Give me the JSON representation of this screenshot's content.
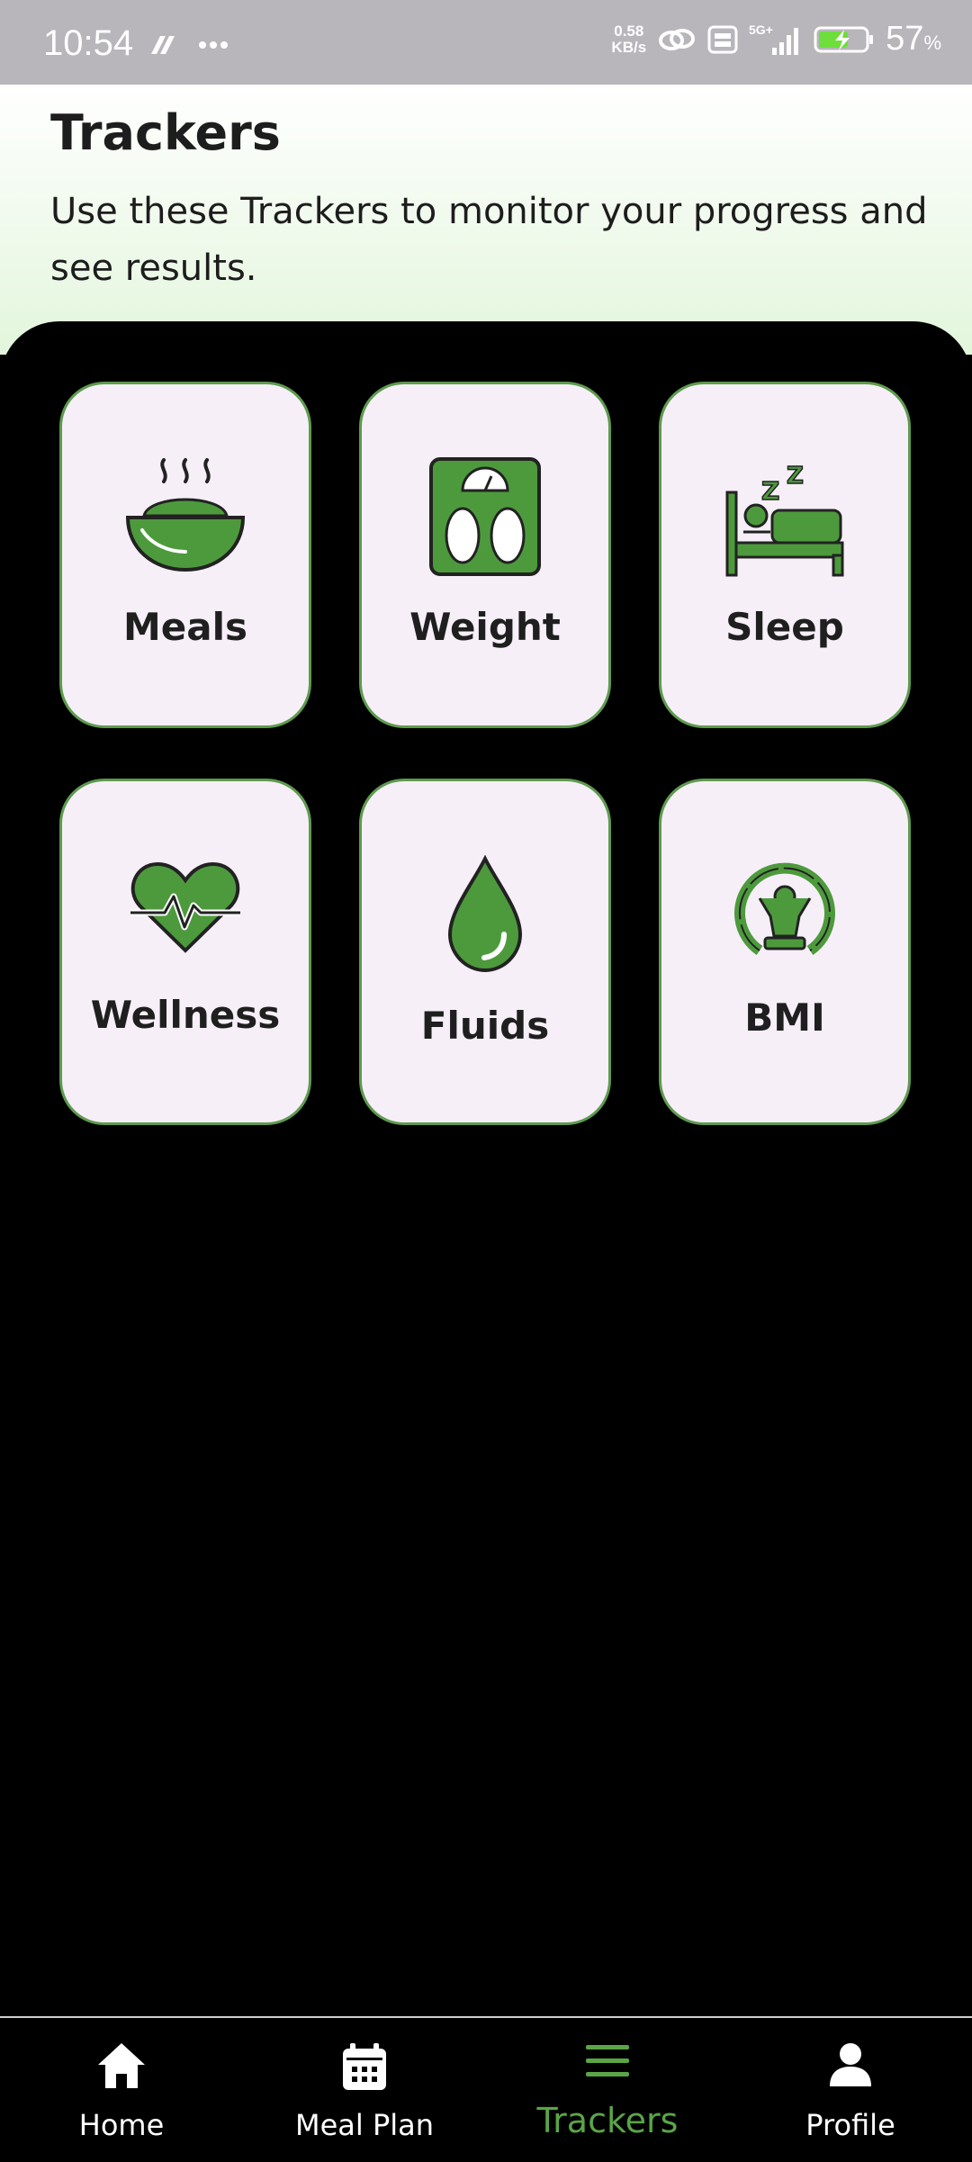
{
  "status_bar": {
    "time": "10:54",
    "speed_value": "0.58",
    "speed_unit": "KB/s",
    "network": "5G+",
    "battery_percent": "57",
    "battery_unit": "%"
  },
  "header": {
    "title": "Trackers",
    "subtitle": "Use these Trackers to monitor your progress and see results."
  },
  "trackers": [
    {
      "label": "Meals",
      "icon": "bowl-icon"
    },
    {
      "label": "Weight",
      "icon": "scale-icon"
    },
    {
      "label": "Sleep",
      "icon": "bed-icon"
    },
    {
      "label": "Wellness",
      "icon": "heart-pulse-icon"
    },
    {
      "label": "Fluids",
      "icon": "droplet-icon"
    },
    {
      "label": "BMI",
      "icon": "bmi-icon"
    }
  ],
  "bottom_nav": [
    {
      "label": "Home",
      "icon": "home-icon"
    },
    {
      "label": "Meal Plan",
      "icon": "calendar-icon"
    },
    {
      "label": "Trackers",
      "icon": "menu-icon",
      "active": true
    },
    {
      "label": "Profile",
      "icon": "profile-icon"
    }
  ],
  "colors": {
    "accent_green": "#5aa547",
    "icon_green": "#4d9a3d",
    "tile_background": "#f6eff7",
    "tile_border": "#5e9a4e",
    "status_bar": "#b8b5bb"
  }
}
